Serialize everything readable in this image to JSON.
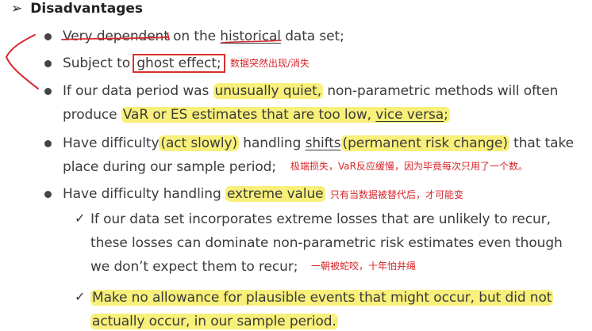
{
  "heading": {
    "bullet": "➢",
    "title": "Disadvantages"
  },
  "items": {
    "i1": {
      "a": "Very dependent",
      "b": " on the ",
      "c": "historical",
      "d": " data set;"
    },
    "i2": {
      "a": "Subject to ",
      "b": "ghost effect;"
    },
    "i3": {
      "l1a": "If our data period was ",
      "l1b": "unusually quiet,",
      "l1c": " non-parametric methods will often",
      "l2a": "produce ",
      "l2b": "VaR or ES estimates that are too low, ",
      "l2c": "vice versa",
      "l2d": ";"
    },
    "i4": {
      "l1a": "Have difficulty",
      "l1b": "(act slowly)",
      "l1c": " handling ",
      "l1d": "shifts",
      "l1e": "(permanent risk change)",
      "l1f": " that take",
      "l2a": "place during our sample period;"
    },
    "i5": {
      "a": "Have difficulty handling ",
      "b": "extreme value"
    },
    "s1": {
      "check": "✓",
      "l1": "If our data set incorporates extreme losses that are unlikely to recur,",
      "l2": "these losses can dominate non-parametric risk estimates even though",
      "l3": "we don’t expect them to recur;"
    },
    "s2": {
      "check": "✓",
      "l1": "Make no allowance for plausible events that might occur, but did not",
      "l2": "actually occur, in our sample period."
    }
  },
  "notes": {
    "n1": "数据突然出现/消失",
    "n2": "极端损失，VaR反应缓慢，因为毕竟每次只用了一个数。",
    "n3": "只有当数据被替代后，才可能变",
    "n4": "一朝被蛇咬，十年怕井绳"
  },
  "colors": {
    "highlight": "#f8f07a",
    "annotation": "#d7262b",
    "text": "#3b3b3b"
  }
}
